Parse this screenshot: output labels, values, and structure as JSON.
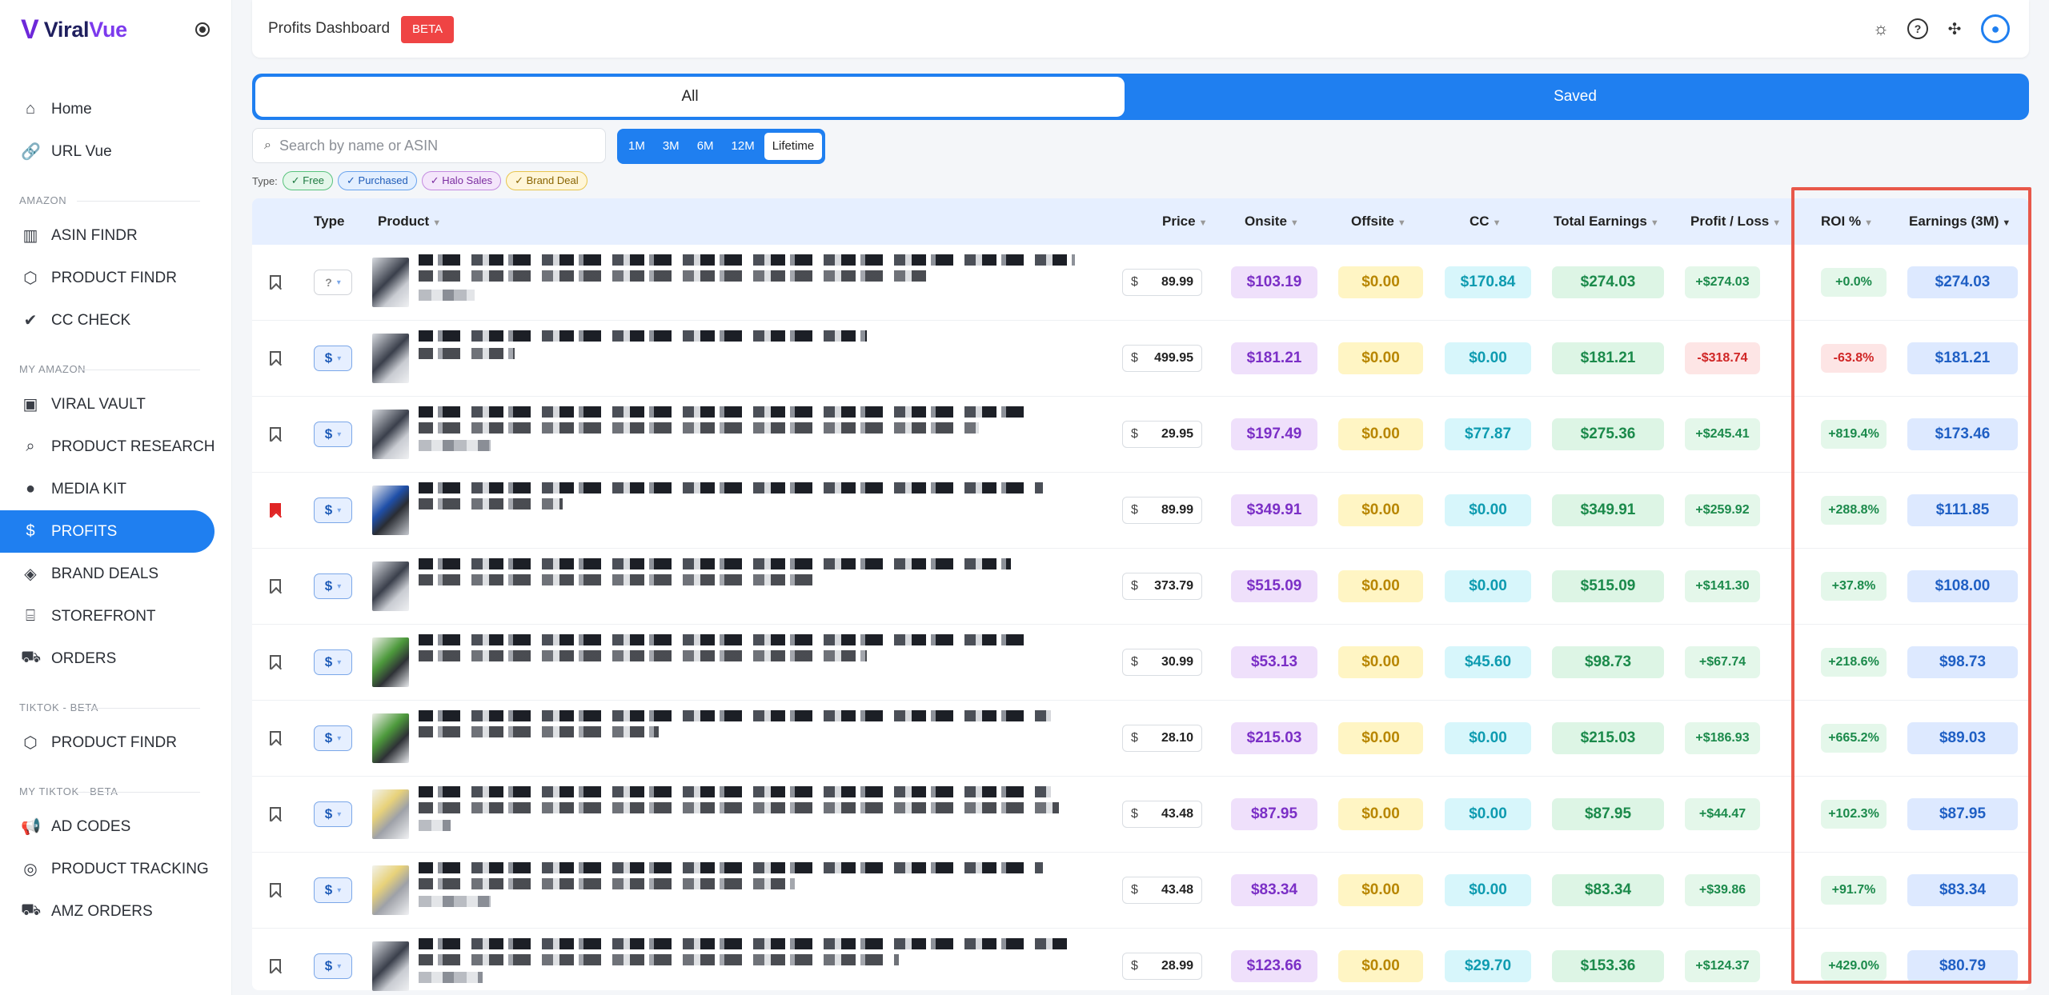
{
  "brand": {
    "logo_mark": "V",
    "name_a": "Viral",
    "name_b": "Vue"
  },
  "sidebar": {
    "items": [
      {
        "type": "item",
        "icon": "⌂",
        "icon_name": "home-icon",
        "label": "Home"
      },
      {
        "type": "item",
        "icon": "🔗",
        "icon_name": "link-icon",
        "label": "URL Vue"
      },
      {
        "type": "section",
        "label": "AMAZON"
      },
      {
        "type": "item",
        "icon": "▥",
        "icon_name": "barcode-icon",
        "label": "ASIN FINDR"
      },
      {
        "type": "item",
        "icon": "⬡",
        "icon_name": "box-icon",
        "label": "PRODUCT FINDR"
      },
      {
        "type": "item",
        "icon": "✔",
        "icon_name": "check-badge-icon",
        "label": "CC CHECK"
      },
      {
        "type": "section",
        "label": "MY AMAZON"
      },
      {
        "type": "item",
        "icon": "▣",
        "icon_name": "vault-icon",
        "label": "VIRAL VAULT"
      },
      {
        "type": "item",
        "icon": "⌕",
        "icon_name": "search-icon",
        "label": "PRODUCT RESEARCH"
      },
      {
        "type": "item",
        "icon": "●",
        "icon_name": "user-icon",
        "label": "MEDIA KIT"
      },
      {
        "type": "item",
        "icon": "$",
        "icon_name": "dollar-icon",
        "label": "PROFITS",
        "active": true
      },
      {
        "type": "item",
        "icon": "◈",
        "icon_name": "handshake-icon",
        "label": "BRAND DEALS"
      },
      {
        "type": "item",
        "icon": "⌸",
        "icon_name": "storefront-icon",
        "label": "STOREFRONT"
      },
      {
        "type": "item",
        "icon": "⛟",
        "icon_name": "cart-icon",
        "label": "ORDERS"
      },
      {
        "type": "section",
        "label": "TIKTOK - BETA"
      },
      {
        "type": "item",
        "icon": "⬡",
        "icon_name": "box-icon",
        "label": "PRODUCT FINDR"
      },
      {
        "type": "section",
        "label": "MY TIKTOK - BETA"
      },
      {
        "type": "item",
        "icon": "📢",
        "icon_name": "megaphone-icon",
        "label": "AD CODES"
      },
      {
        "type": "item",
        "icon": "◎",
        "icon_name": "target-icon",
        "label": "PRODUCT TRACKING"
      },
      {
        "type": "item",
        "icon": "⛟",
        "icon_name": "cart-icon",
        "label": "AMZ ORDERS"
      }
    ]
  },
  "header": {
    "title": "Profits Dashboard",
    "badge": "BETA",
    "help_icon": "?"
  },
  "tabs": {
    "all": "All",
    "saved": "Saved"
  },
  "search": {
    "placeholder": "Search by name or ASIN",
    "value": ""
  },
  "ranges": [
    {
      "label": "1M",
      "selected": false
    },
    {
      "label": "3M",
      "selected": false
    },
    {
      "label": "6M",
      "selected": false
    },
    {
      "label": "12M",
      "selected": false
    },
    {
      "label": "Lifetime",
      "selected": true
    }
  ],
  "type_filter": {
    "label": "Type:",
    "chips": [
      "✓ Free",
      "✓ Purchased",
      "✓ Halo Sales",
      "✓ Brand Deal"
    ]
  },
  "table": {
    "columns": {
      "type": "Type",
      "product": "Product",
      "price": "Price",
      "onsite": "Onsite",
      "offsite": "Offsite",
      "cc": "CC",
      "total": "Total Earnings",
      "pl": "Profit / Loss",
      "roi": "ROI %",
      "earn": "Earnings (3M)"
    },
    "currency_symbol": "$",
    "rows": [
      {
        "saved": false,
        "type": "?",
        "price": "89.99",
        "onsite": "$103.19",
        "offsite": "$0.00",
        "cc": "$170.84",
        "total": "$274.03",
        "pl": "+$274.03",
        "pl_neg": false,
        "roi": "+0.0%",
        "roi_neg": false,
        "earn": "$274.03"
      },
      {
        "saved": false,
        "type": "$",
        "price": "499.95",
        "onsite": "$181.21",
        "offsite": "$0.00",
        "cc": "$0.00",
        "total": "$181.21",
        "pl": "-$318.74",
        "pl_neg": true,
        "roi": "-63.8%",
        "roi_neg": true,
        "earn": "$181.21"
      },
      {
        "saved": false,
        "type": "$",
        "price": "29.95",
        "onsite": "$197.49",
        "offsite": "$0.00",
        "cc": "$77.87",
        "total": "$275.36",
        "pl": "+$245.41",
        "pl_neg": false,
        "roi": "+819.4%",
        "roi_neg": false,
        "earn": "$173.46"
      },
      {
        "saved": true,
        "type": "$",
        "price": "89.99",
        "onsite": "$349.91",
        "offsite": "$0.00",
        "cc": "$0.00",
        "total": "$349.91",
        "pl": "+$259.92",
        "pl_neg": false,
        "roi": "+288.8%",
        "roi_neg": false,
        "earn": "$111.85"
      },
      {
        "saved": false,
        "type": "$",
        "price": "373.79",
        "onsite": "$515.09",
        "offsite": "$0.00",
        "cc": "$0.00",
        "total": "$515.09",
        "pl": "+$141.30",
        "pl_neg": false,
        "roi": "+37.8%",
        "roi_neg": false,
        "earn": "$108.00"
      },
      {
        "saved": false,
        "type": "$",
        "price": "30.99",
        "onsite": "$53.13",
        "offsite": "$0.00",
        "cc": "$45.60",
        "total": "$98.73",
        "pl": "+$67.74",
        "pl_neg": false,
        "roi": "+218.6%",
        "roi_neg": false,
        "earn": "$98.73"
      },
      {
        "saved": false,
        "type": "$",
        "price": "28.10",
        "onsite": "$215.03",
        "offsite": "$0.00",
        "cc": "$0.00",
        "total": "$215.03",
        "pl": "+$186.93",
        "pl_neg": false,
        "roi": "+665.2%",
        "roi_neg": false,
        "earn": "$89.03"
      },
      {
        "saved": false,
        "type": "$",
        "price": "43.48",
        "onsite": "$87.95",
        "offsite": "$0.00",
        "cc": "$0.00",
        "total": "$87.95",
        "pl": "+$44.47",
        "pl_neg": false,
        "roi": "+102.3%",
        "roi_neg": false,
        "earn": "$87.95"
      },
      {
        "saved": false,
        "type": "$",
        "price": "43.48",
        "onsite": "$83.34",
        "offsite": "$0.00",
        "cc": "$0.00",
        "total": "$83.34",
        "pl": "+$39.86",
        "pl_neg": false,
        "roi": "+91.7%",
        "roi_neg": false,
        "earn": "$83.34"
      },
      {
        "saved": false,
        "type": "$",
        "price": "28.99",
        "onsite": "$123.66",
        "offsite": "$0.00",
        "cc": "$29.70",
        "total": "$153.36",
        "pl": "+$124.37",
        "pl_neg": false,
        "roi": "+429.0%",
        "roi_neg": false,
        "earn": "$80.79"
      }
    ]
  },
  "colors": {
    "primary": "#1f7ff0",
    "highlight": "#e8584a",
    "badge": "#ef4444"
  }
}
